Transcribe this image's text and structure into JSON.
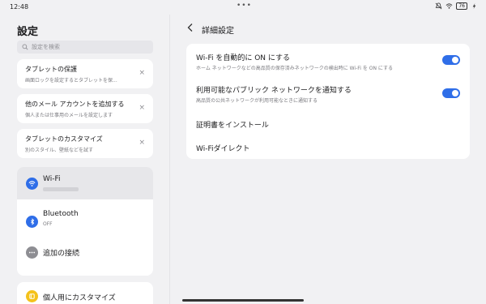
{
  "status": {
    "time": "12:48",
    "battery": "76"
  },
  "left": {
    "title": "設定",
    "search_placeholder": "設定を検索",
    "suggestions": [
      {
        "title": "タブレットの保護",
        "subtitle": "画面ロックを設定するとタブレットを保..."
      },
      {
        "title": "他のメール アカウントを追加する",
        "subtitle": "個人または仕事用のメールを設定します"
      },
      {
        "title": "タブレットのカスタマイズ",
        "subtitle": "別のスタイル、壁紙などを試す"
      }
    ],
    "close_symbol": "×",
    "connections": [
      {
        "label": "Wi-Fi",
        "subtitle": ""
      },
      {
        "label": "Bluetooth",
        "subtitle": "OFF"
      },
      {
        "label": "追加の接続",
        "subtitle": ""
      }
    ],
    "customize_label": "個人用にカスタマイズ"
  },
  "right": {
    "title": "詳細設定",
    "rows": [
      {
        "title": "Wi-Fi を自動的に ON にする",
        "subtitle": "ホーム ネットワークなどの高品質の保存済みネットワークの検出時に Wi-Fi を ON にする"
      },
      {
        "title": "利用可能なパブリック ネットワークを通知する",
        "subtitle": "高品質の公共ネットワークが利用可能なときに通知する"
      },
      {
        "title": "証明書をインストール"
      },
      {
        "title": "Wi-Fiダイレクト"
      }
    ]
  },
  "colors": {
    "accent": "#2f6ee8",
    "wifi_icon": "#2f6ee8",
    "bluetooth_icon": "#2f6ee8",
    "more_icon": "#8e8e93",
    "customize_icon": "#f4c21b"
  },
  "icons": {
    "wifi": "wifi-icon",
    "bluetooth": "bluetooth-icon",
    "more": "more-connections-icon",
    "customize": "customize-icon"
  }
}
